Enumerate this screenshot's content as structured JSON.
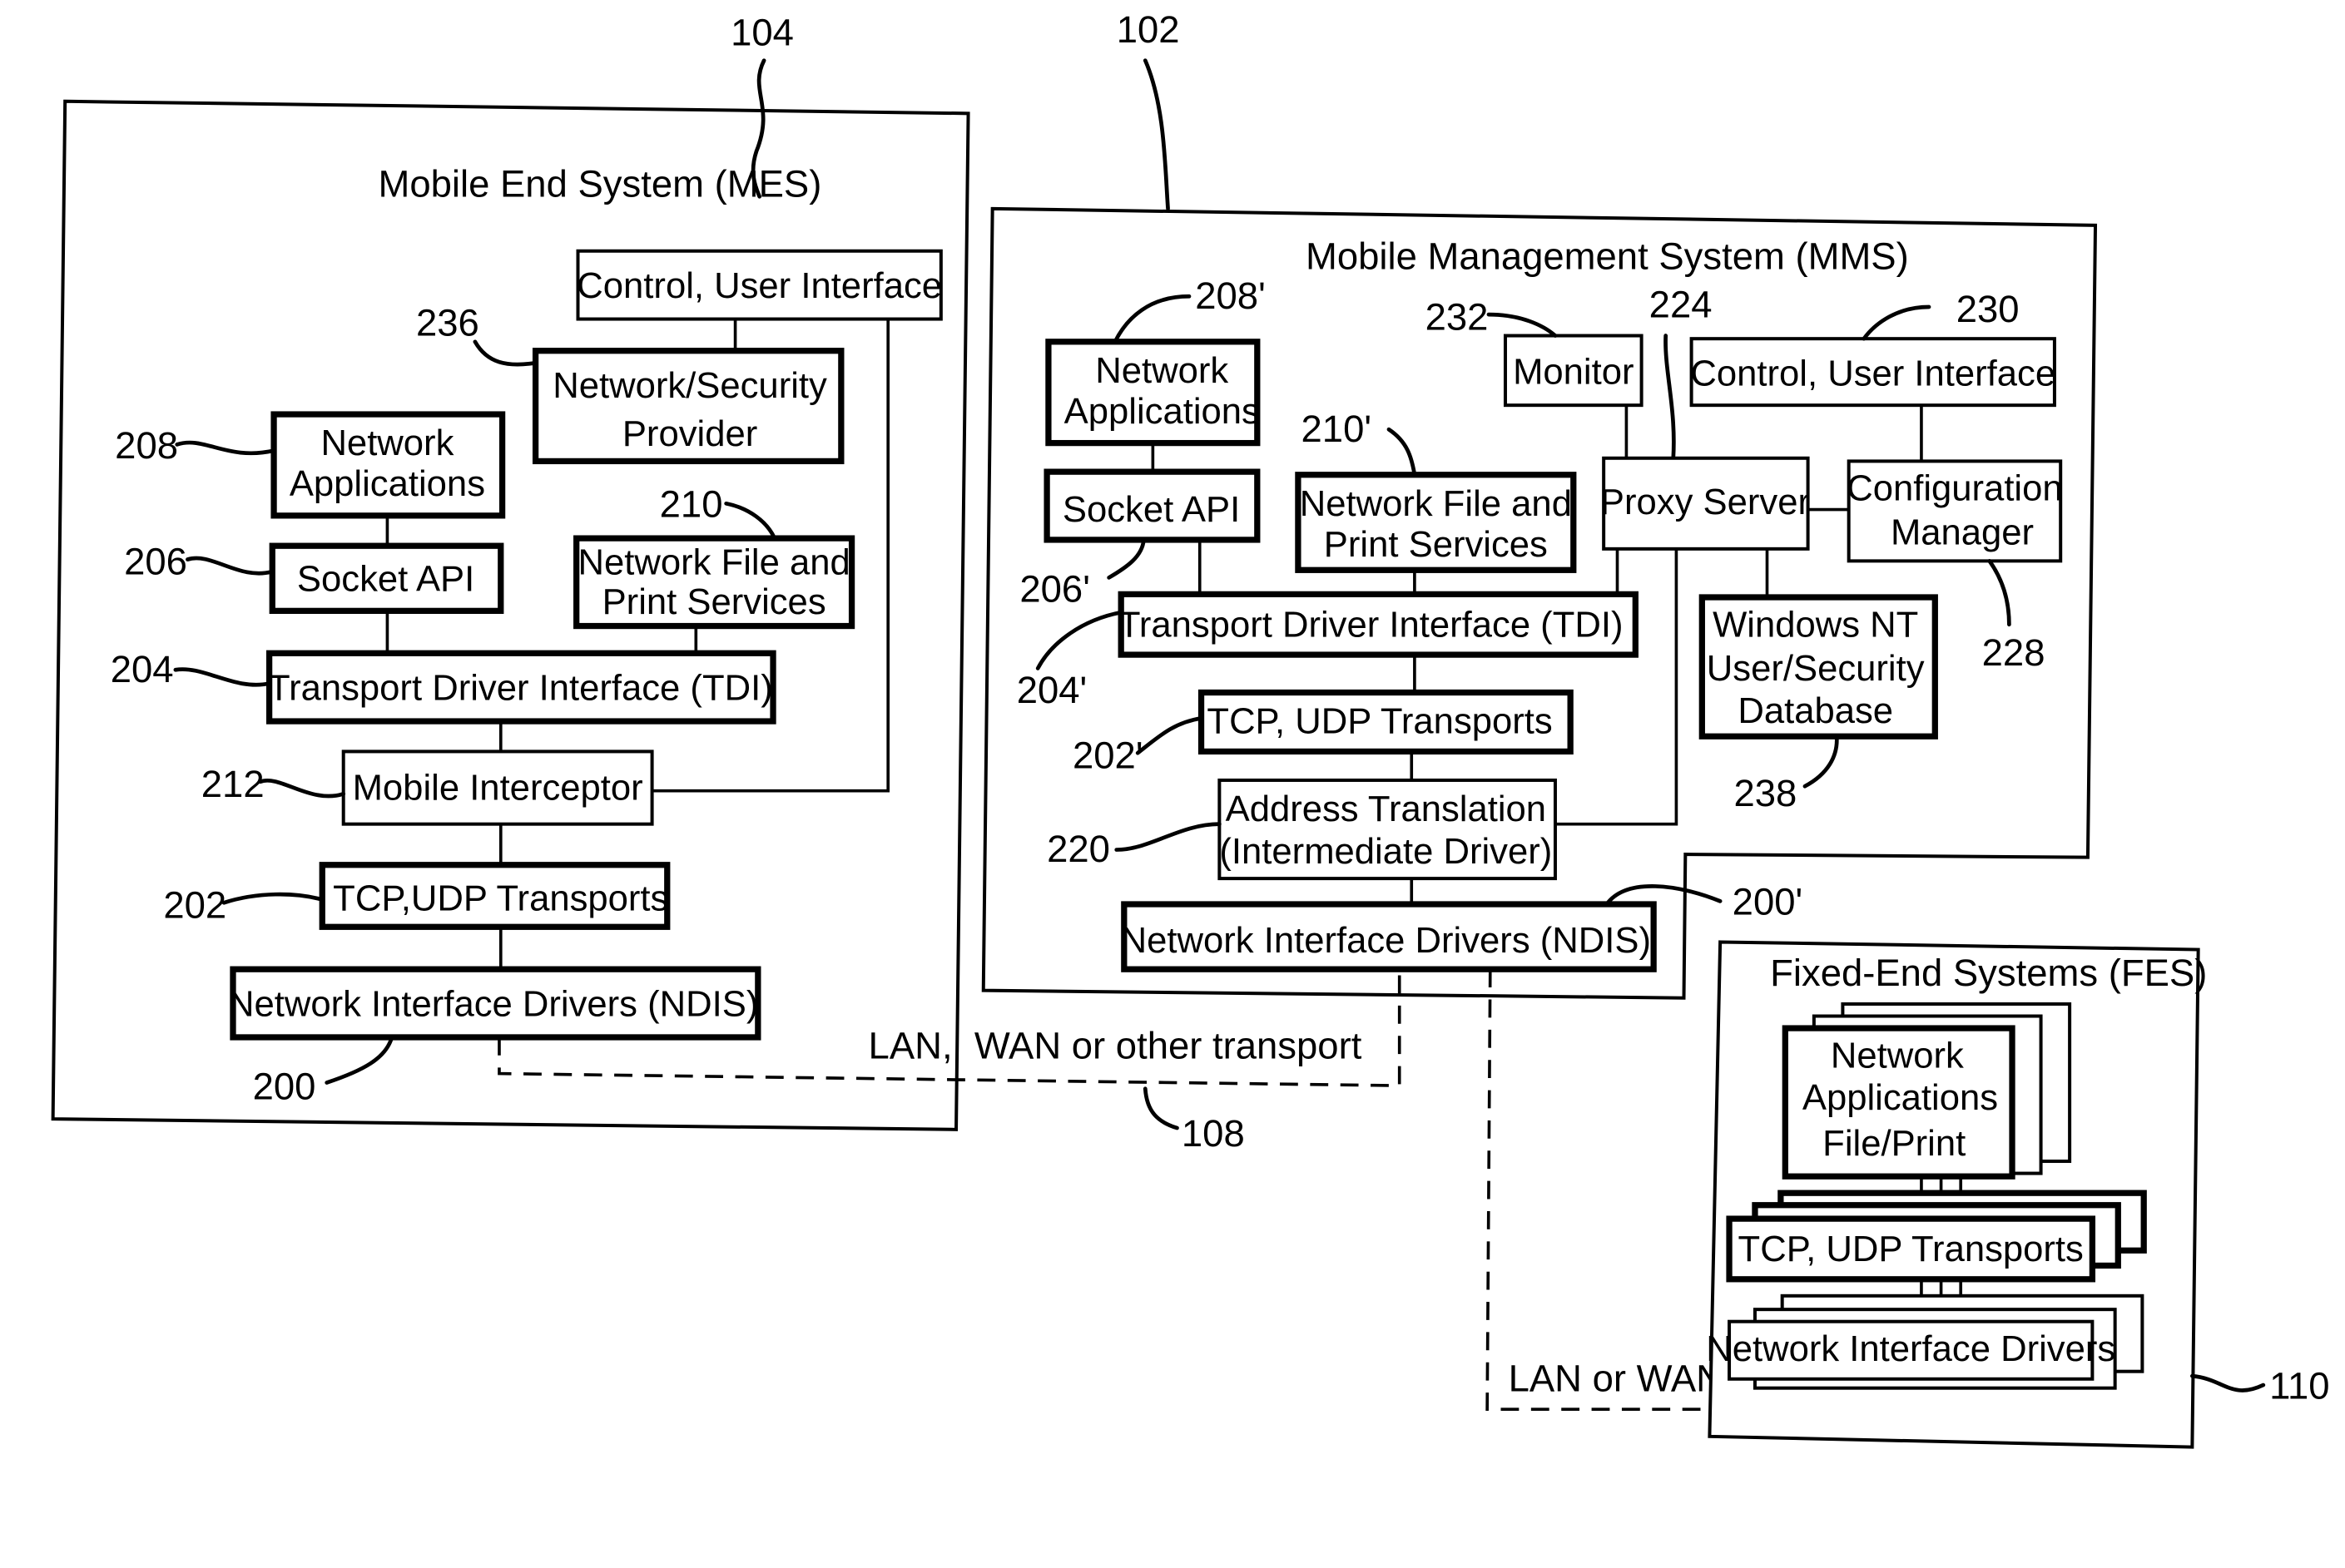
{
  "figure": {
    "mes": {
      "ref": "104",
      "title": "Mobile End System (MES)",
      "boxes": {
        "control_ui": "Control, User Interface",
        "net_security_1": "Network/Security",
        "net_security_2": "Provider",
        "net_apps_1": "Network",
        "net_apps_2": "Applications",
        "socket_api": "Socket API",
        "file_print_1": "Network File and",
        "file_print_2": "Print Services",
        "tdi": "Transport Driver Interface (TDI)",
        "interceptor": "Mobile Interceptor",
        "tcp_udp": "TCP,UDP Transports",
        "ndis": "Network Interface Drivers (NDIS)"
      },
      "refs": {
        "net_security": "236",
        "net_apps": "208",
        "socket_api": "206",
        "file_print": "210",
        "tdi": "204",
        "interceptor": "212",
        "tcp_udp": "202",
        "ndis": "200"
      }
    },
    "mms": {
      "ref": "102",
      "title": "Mobile Management System (MMS)",
      "boxes": {
        "net_apps_1": "Network",
        "net_apps_2": "Applications",
        "socket_api": "Socket API",
        "file_print_1": "Network File and",
        "file_print_2": "Print Services",
        "monitor": "Monitor",
        "control_ui": "Control, User Interface",
        "proxy": "Proxy Server",
        "config_1": "Configuration",
        "config_2": "Manager",
        "tdi": "Transport Driver Interface (TDI)",
        "winnt_1": "Windows NT",
        "winnt_2": "User/Security",
        "winnt_3": "Database",
        "tcp_udp": "TCP, UDP Transports",
        "addr_1": "Address Translation",
        "addr_2": "(Intermediate Driver)",
        "ndis": "Network Interface Drivers (NDIS)"
      },
      "refs": {
        "net_apps": "208'",
        "socket_api": "206'",
        "file_print": "210'",
        "monitor": "232",
        "proxy": "224",
        "control_ui": "230",
        "config": "228",
        "tdi": "204'",
        "winnt": "238",
        "tcp_udp": "202'",
        "addr": "220",
        "ndis": "200'"
      }
    },
    "fes": {
      "ref": "110",
      "title": "Fixed-End Systems (FES)",
      "boxes": {
        "apps_1": "Network",
        "apps_2": "Applications",
        "apps_3": "File/Print",
        "tcp_udp": "TCP, UDP Transports",
        "nid": "Network Interface Drivers"
      }
    },
    "links": {
      "wan_label_a": "LAN,",
      "wan_label_b": "WAN or other transport",
      "wan_ref": "108",
      "lan_label": "LAN or WAN"
    }
  }
}
